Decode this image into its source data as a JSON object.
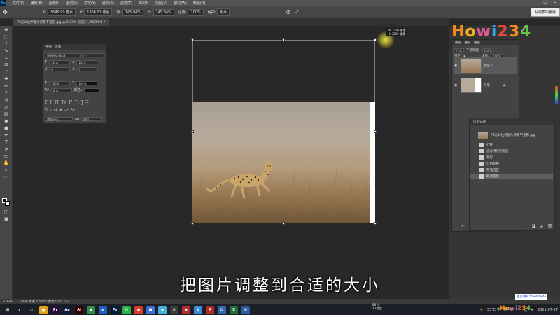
{
  "app": {
    "logo": "Ps",
    "menu": [
      "文件(F)",
      "编辑(E)",
      "图像(I)",
      "图层(L)",
      "文字(Y)",
      "选择(S)",
      "滤镜(T)",
      "3D(D)",
      "视图(V)",
      "窗口(W)",
      "帮助(H)"
    ],
    "window_controls": [
      "—",
      "☐",
      "✕"
    ]
  },
  "options_bar": {
    "x_label": "X:",
    "x_value": "3645.99 像素",
    "y_label": "Y:",
    "y_value": "1304.01 像素",
    "w_label": "W:",
    "w_value": "145.84%",
    "h_label": "H:",
    "h_value": "145.84%",
    "angle_value": "0.00",
    "h2_value": "0.00",
    "v_value": "0.00",
    "interp_label": "插值:",
    "interp_value": "两次立方(自动)",
    "opacity_label": "设置:",
    "opacity_value": "100%",
    "warp_label": "保护:",
    "warp_value": "默认",
    "cancel_icon": "cancel-icon",
    "commit_icon": "check-icon"
  },
  "tooltip_remove": "从列表中删除",
  "document_tab": "PS怎么拉伸图片背景不变形.jpg @ 8.33% (图层 1, RGB/8*) *",
  "character_panel": {
    "tabs": [
      "字符",
      "段落"
    ],
    "font_family": "新细明体-ExtB",
    "font_style": "-",
    "font_size": "12 点",
    "leading": "24 点",
    "tracking": "0",
    "kerning": "0",
    "scale_v": "100%",
    "scale_h": "100%",
    "baseline": "0 点",
    "color_label": "颜色:",
    "lang": "美国英语",
    "aa": "锐利"
  },
  "transform_tip": {
    "w": "W: 7292 像素",
    "h": "H: 7292 像素"
  },
  "watermark": "Howi234",
  "layers_panel": {
    "tabs": [
      "图层",
      "通道",
      "路径"
    ],
    "blend": "正常",
    "opacity_label": "不透明度:",
    "opacity": "100%",
    "lock_label": "锁定:",
    "fill_label": "填充:",
    "fill": "100%",
    "layers": [
      {
        "name": "图层 1"
      },
      {
        "name": "背景"
      }
    ]
  },
  "history_panel": {
    "title": "历史记录",
    "snapshot": "PS怎么拉伸图片背景不变形.jpg",
    "items": [
      "打开",
      "通过拷贝的图层",
      "裁剪",
      "自由变换",
      "存储选区",
      "取消选择"
    ],
    "selected_index": 5
  },
  "subtitle": "把图片调整到合适的大小",
  "status": {
    "zoom": "8.33%",
    "doc": "7996 像素 x 5000 像素 (300 ppi)"
  },
  "taskbar": {
    "weather": "33°C 空气优 48",
    "cpu_temp": "68°C",
    "cpu_label": "CPU温度",
    "date": "2021-07-27",
    "time": "",
    "promo_text": "主页请(Ctrl+Alt+A)",
    "promo_logo": "Howi234",
    "apps": [
      {
        "icon": "windows-icon",
        "label": "⊞",
        "color": "#1c1f26"
      },
      {
        "icon": "search-icon",
        "label": "⌕",
        "color": "#1c1f26"
      },
      {
        "icon": "taskview-icon",
        "label": "▭",
        "color": "#1c1f26"
      },
      {
        "icon": "folder-icon",
        "label": "▆",
        "color": "#e3a21a"
      },
      {
        "icon": "premiere-icon",
        "label": "Pr",
        "color": "#2a0a3a"
      },
      {
        "icon": "aftereffects-icon",
        "label": "Ae",
        "color": "#0b1a3a"
      },
      {
        "icon": "illustrator-icon",
        "label": "Ai",
        "color": "#330000"
      },
      {
        "icon": "chrome-icon",
        "label": "●",
        "color": "#2f8f44"
      },
      {
        "icon": "edge-icon",
        "label": "e",
        "color": "#1e60c8"
      },
      {
        "icon": "photoshop-icon",
        "label": "Ps",
        "color": "#001e36"
      },
      {
        "icon": "wechat-icon",
        "label": "✉",
        "color": "#2bb34a"
      },
      {
        "icon": "game-icon",
        "label": "●",
        "color": "#d93d2a"
      },
      {
        "icon": "tv-icon",
        "label": "■",
        "color": "#3a6fe0"
      },
      {
        "icon": "media-icon",
        "label": "◆",
        "color": "#44b0e0"
      },
      {
        "icon": "settings-icon",
        "label": "⚙",
        "color": "#3b3b3b"
      },
      {
        "icon": "record-icon",
        "label": "◉",
        "color": "#b03030"
      },
      {
        "icon": "app-icon",
        "label": "▦",
        "color": "#3b8bd8"
      },
      {
        "icon": "access-icon",
        "label": "A",
        "color": "#b22a2a"
      },
      {
        "icon": "notes-icon",
        "label": "▤",
        "color": "#2f6aad"
      },
      {
        "icon": "excel-icon",
        "label": "X",
        "color": "#1d6f42"
      },
      {
        "icon": "docs-icon",
        "label": "▥",
        "color": "#2c5aa0"
      }
    ]
  }
}
